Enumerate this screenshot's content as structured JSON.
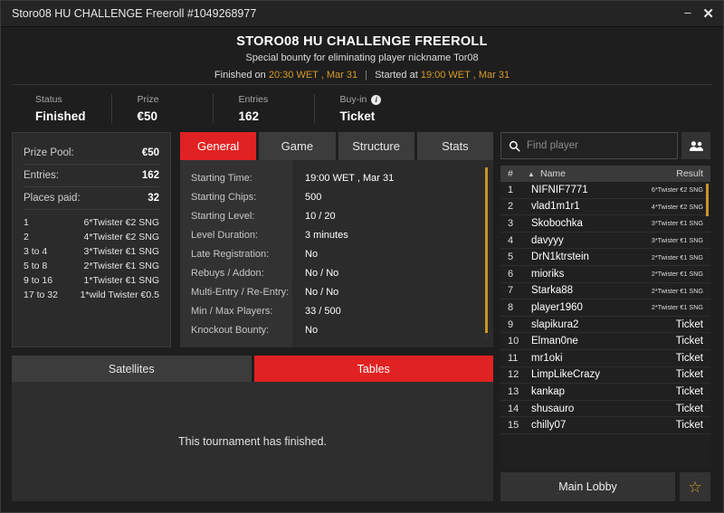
{
  "window": {
    "title": "Storo08 HU CHALLENGE Freeroll #1049268977",
    "minimize_label": "–",
    "close_label": "✕"
  },
  "header": {
    "title": "STORO08 HU CHALLENGE FREEROLL",
    "subtitle": "Special bounty for eliminating player nickname Tor08",
    "finished_prefix": "Finished on",
    "finished_time": "20:30 WET , Mar 31",
    "divider": "|",
    "started_prefix": "Started at",
    "started_time": "19:00 WET , Mar 31"
  },
  "status_strip": [
    {
      "label": "Status",
      "value": "Finished",
      "info": false
    },
    {
      "label": "Prize",
      "value": "€50",
      "info": false
    },
    {
      "label": "Entries",
      "value": "162",
      "info": false
    },
    {
      "label": "Buy-in",
      "value": "Ticket",
      "info": true,
      "info_glyph": "i"
    }
  ],
  "prize_panel": {
    "rows": [
      {
        "label": "Prize Pool:",
        "value": "€50"
      },
      {
        "label": "Entries:",
        "value": "162"
      },
      {
        "label": "Places paid:",
        "value": "32"
      }
    ],
    "payouts": [
      {
        "rank": "1",
        "prize": "6*Twister €2 SNG"
      },
      {
        "rank": "2",
        "prize": "4*Twister €2 SNG"
      },
      {
        "rank": "3  to  4",
        "prize": "3*Twister €1 SNG"
      },
      {
        "rank": "5  to  8",
        "prize": "2*Twister €1 SNG"
      },
      {
        "rank": "9  to  16",
        "prize": "1*Twister €1 SNG"
      },
      {
        "rank": "17  to  32",
        "prize": "1*wild Twister €0.5"
      }
    ]
  },
  "tabs": [
    {
      "label": "General",
      "active": true
    },
    {
      "label": "Game",
      "active": false
    },
    {
      "label": "Structure",
      "active": false
    },
    {
      "label": "Stats",
      "active": false
    }
  ],
  "general_panel": {
    "rows": [
      {
        "label": "Starting Time:",
        "value": "19:00 WET , Mar 31"
      },
      {
        "label": "Starting Chips:",
        "value": "500"
      },
      {
        "label": "Starting Level:",
        "value": "10 / 20"
      },
      {
        "label": "Level Duration:",
        "value": "3 minutes"
      },
      {
        "label": "Late Registration:",
        "value": "No"
      },
      {
        "label": "Rebuys / Addon:",
        "value": "No / No"
      },
      {
        "label": "Multi-Entry / Re-Entry:",
        "value": "No / No"
      },
      {
        "label": "Min / Max Players:",
        "value": "33 / 500"
      },
      {
        "label": "Knockout Bounty:",
        "value": "No"
      }
    ]
  },
  "lower_tabs": [
    {
      "label": "Satellites",
      "active": false
    },
    {
      "label": "Tables",
      "active": true
    }
  ],
  "lower_panel": {
    "message": "This tournament has finished."
  },
  "search": {
    "placeholder": "Find player",
    "value": "",
    "icon": "search-icon",
    "people_icon": "people-icon"
  },
  "player_table": {
    "columns": {
      "num": "#",
      "sort": "▲",
      "name": "Name",
      "result": "Result"
    },
    "rows": [
      {
        "num": "1",
        "name": "NIFNIF7771",
        "result": "6*Twister €2 SNG",
        "small": true
      },
      {
        "num": "2",
        "name": "vlad1m1r1",
        "result": "4*Twister €2 SNG",
        "small": true
      },
      {
        "num": "3",
        "name": "Skobochka",
        "result": "3*Twister €1 SNG",
        "small": true
      },
      {
        "num": "4",
        "name": "davyyy",
        "result": "3*Twister €1 SNG",
        "small": true
      },
      {
        "num": "5",
        "name": "DrN1ktrstein",
        "result": "2*Twister €1 SNG",
        "small": true
      },
      {
        "num": "6",
        "name": "mioriks",
        "result": "2*Twister €1 SNG",
        "small": true
      },
      {
        "num": "7",
        "name": "Starka88",
        "result": "2*Twister €1 SNG",
        "small": true
      },
      {
        "num": "8",
        "name": "player1960",
        "result": "2*Twister €1 SNG",
        "small": true
      },
      {
        "num": "9",
        "name": "slapikura2",
        "result": "Ticket",
        "small": false
      },
      {
        "num": "10",
        "name": "Elman0ne",
        "result": "Ticket",
        "small": false
      },
      {
        "num": "11",
        "name": "mr1oki",
        "result": "Ticket",
        "small": false
      },
      {
        "num": "12",
        "name": "LimpLikeCrazy",
        "result": "Ticket",
        "small": false
      },
      {
        "num": "13",
        "name": "kankap",
        "result": "Ticket",
        "small": false
      },
      {
        "num": "14",
        "name": "shusauro",
        "result": "Ticket",
        "small": false
      },
      {
        "num": "15",
        "name": "chilly07",
        "result": "Ticket",
        "small": false
      }
    ]
  },
  "footer": {
    "main_lobby_label": "Main Lobby",
    "favourite_icon": "star-icon",
    "favourite_glyph": "☆"
  },
  "colors": {
    "accent_red": "#e02222",
    "gold": "#d79b2b",
    "window_bg": "#1e1e1e",
    "panel_bg": "#2b2b2b",
    "tab_inactive": "#3c3c3c"
  }
}
